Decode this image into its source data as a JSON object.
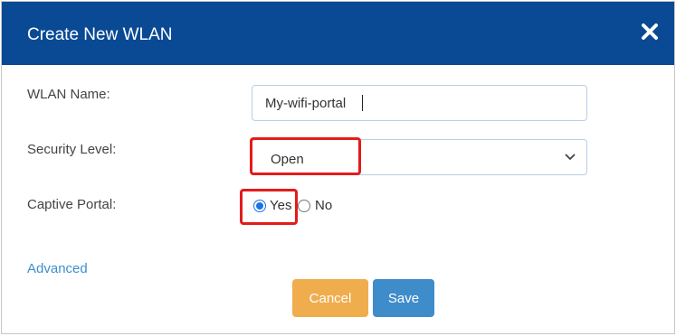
{
  "dialog": {
    "title": "Create New WLAN",
    "close_icon": "close-icon"
  },
  "form": {
    "wlan_name": {
      "label": "WLAN Name:",
      "value": "My-wifi-portal"
    },
    "security_level": {
      "label": "Security Level:",
      "selected": "Open"
    },
    "captive_portal": {
      "label": "Captive Portal:",
      "options": [
        {
          "label": "Yes",
          "checked": true
        },
        {
          "label": "No",
          "checked": false
        }
      ]
    },
    "advanced_link": "Advanced"
  },
  "buttons": {
    "cancel": "Cancel",
    "save": "Save"
  },
  "colors": {
    "titlebar": "#0a4a95",
    "cancel": "#f0ad4e",
    "save": "#3f8ccb",
    "link": "#3d8fcc",
    "highlight": "#e41b1b",
    "radio_selected": "#1a73e8"
  }
}
